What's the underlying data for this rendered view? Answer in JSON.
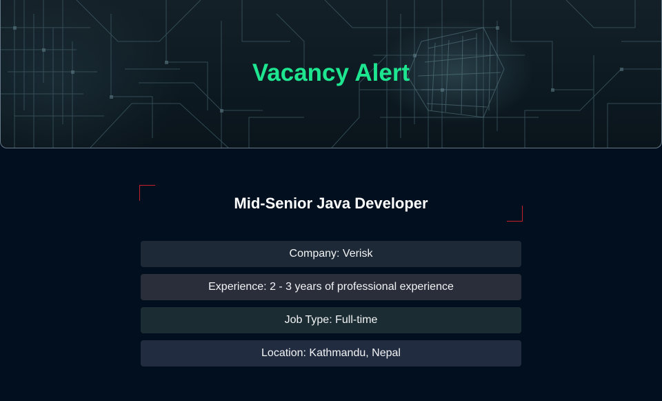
{
  "header": {
    "title": "Vacancy Alert"
  },
  "job": {
    "title": "Mid-Senior Java Developer",
    "details": [
      {
        "label": "Company",
        "value": "Verisk",
        "text": "Company: Verisk"
      },
      {
        "label": "Experience",
        "value": "2 - 3 years of professional experience",
        "text": "Experience: 2 - 3 years of professional experience"
      },
      {
        "label": "Job Type",
        "value": "Full-time",
        "text": "Job Type: Full-time"
      },
      {
        "label": "Location",
        "value": "Kathmandu, Nepal",
        "text": "Location: Kathmandu, Nepal"
      }
    ]
  },
  "colors": {
    "page_background": "#020f1f",
    "title_accent": "#1ee58f",
    "corner_accent": "#c8202a",
    "row_company": "#1e2937",
    "row_experience": "#292e3a",
    "row_jobtype": "#1c2c33",
    "row_location": "#222c41"
  }
}
